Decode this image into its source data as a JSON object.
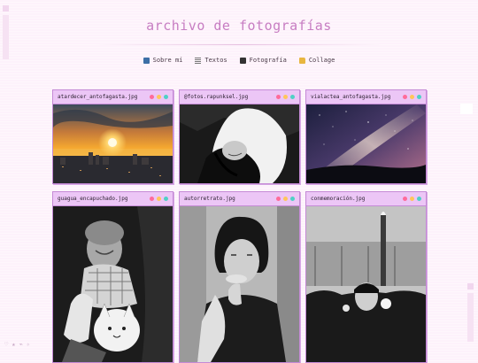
{
  "header": {
    "title": "archivo de fotografías"
  },
  "nav": [
    {
      "label": "Sobre mí",
      "icon": "person-icon"
    },
    {
      "label": "Textos",
      "icon": "lines-icon"
    },
    {
      "label": "Fotografía",
      "icon": "camera-icon"
    },
    {
      "label": "Collage",
      "icon": "folder-icon"
    }
  ],
  "windows": [
    {
      "filename": "atardecer_antofagasta.jpg"
    },
    {
      "filename": "@fotos.rapunksel.jpg"
    },
    {
      "filename": "vialactea_antofagasta.jpg"
    },
    {
      "filename": "guagua_encapuchado.jpg"
    },
    {
      "filename": "autorretrato.jpg"
    },
    {
      "filename": "conmemoración.jpg"
    }
  ],
  "colors": {
    "accent": "#c77dc2",
    "window_bar": "#ecc6f6",
    "window_border": "#c58ad6",
    "dot_red": "#ff6b9a",
    "dot_yellow": "#ffc65a",
    "dot_teal": "#4fd1c5"
  }
}
